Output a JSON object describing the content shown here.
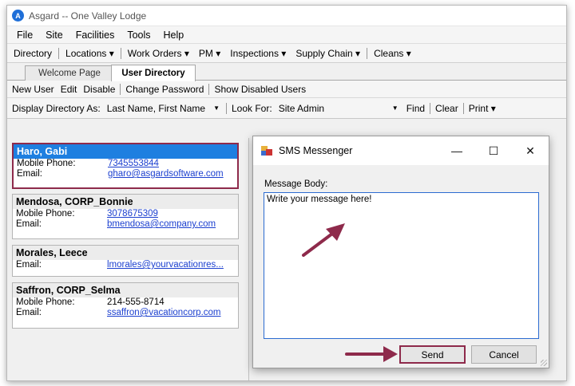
{
  "window": {
    "title": "Asgard -- One Valley Lodge"
  },
  "menu": [
    "File",
    "Site",
    "Facilities",
    "Tools",
    "Help"
  ],
  "nav": [
    "Directory",
    "Locations ▾",
    "Work Orders ▾",
    "PM ▾",
    "Inspections ▾",
    "Supply Chain ▾",
    "Cleans ▾"
  ],
  "tabs": [
    {
      "label": "Welcome Page",
      "active": false
    },
    {
      "label": "User Directory",
      "active": true
    }
  ],
  "toolbar": [
    "New User",
    "Edit",
    "Disable",
    "Change Password",
    "Show Disabled Users"
  ],
  "filter": {
    "display_label": "Display Directory As:",
    "display_value": "Last Name, First Name",
    "look_label": "Look For:",
    "look_value": "Site Admin",
    "find": "Find",
    "clear": "Clear",
    "print": "Print ▾"
  },
  "contacts": [
    {
      "name": "Haro, Gabi",
      "selected": true,
      "rows": [
        {
          "k": "Mobile Phone:",
          "v": "7345553844",
          "link": true
        },
        {
          "k": "Email:",
          "v": "gharo@asgardsoftware.com",
          "link": true
        }
      ]
    },
    {
      "name": "Mendosa, CORP_Bonnie",
      "selected": false,
      "rows": [
        {
          "k": "Mobile Phone:",
          "v": "3078675309",
          "link": true
        },
        {
          "k": "Email:",
          "v": "bmendosa@company.com",
          "link": true
        }
      ]
    },
    {
      "name": "Morales, Leece",
      "selected": false,
      "rows": [
        {
          "k": "Email:",
          "v": "lmorales@yourvacationres...",
          "link": true
        }
      ]
    },
    {
      "name": "Saffron, CORP_Selma",
      "selected": false,
      "rows": [
        {
          "k": "Mobile Phone:",
          "v": "214-555-8714",
          "link": false
        },
        {
          "k": "Email:",
          "v": "ssaffron@vacationcorp.com",
          "link": true
        }
      ]
    }
  ],
  "dialog": {
    "title": "SMS Messenger",
    "label": "Message Body:",
    "message": "Write your message here!",
    "send": "Send",
    "cancel": "Cancel",
    "win_min": "—",
    "win_max": "☐",
    "win_close": "✕"
  },
  "colors": {
    "accent": "#8e2a4b",
    "selection": "#1e7fe0",
    "link": "#1b3fcf"
  }
}
